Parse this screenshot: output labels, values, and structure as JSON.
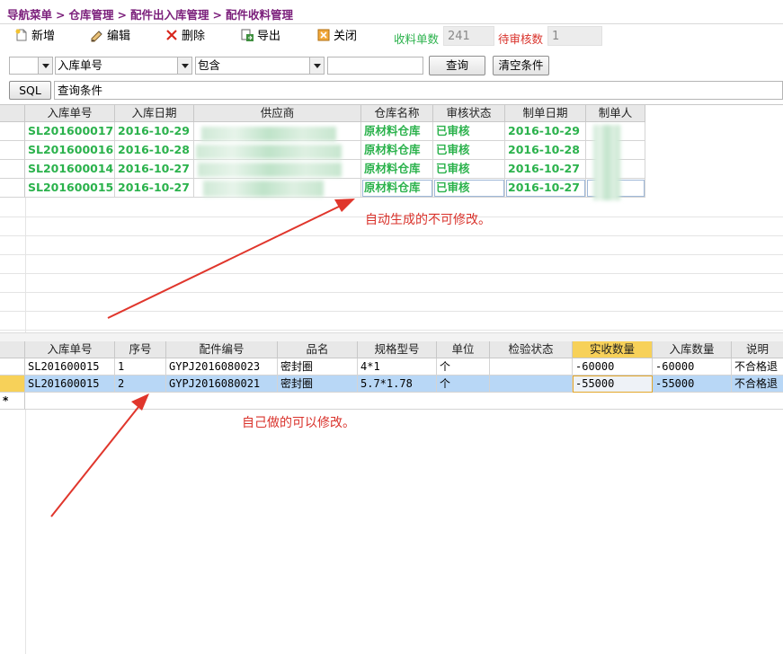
{
  "breadcrumb": [
    "导航菜单",
    "仓库管理",
    "配件出入库管理",
    "配件收料管理"
  ],
  "breadcrumb_sep": ">",
  "toolbar": {
    "new_label": "新增",
    "edit_label": "编辑",
    "delete_label": "删除",
    "export_label": "导出",
    "close_label": "关闭",
    "received_count_label": "收料单数",
    "received_count_value": "241",
    "pending_review_label": "待审核数",
    "pending_review_value": "1"
  },
  "filter": {
    "field_value": "入库单号",
    "operator_value": "包含",
    "query_button": "查询",
    "clear_button": "清空条件",
    "sql_button": "SQL",
    "condition_text": "查询条件"
  },
  "master_grid": {
    "columns": [
      "入库单号",
      "入库日期",
      "供应商",
      "仓库名称",
      "审核状态",
      "制单日期",
      "制单人"
    ],
    "rows": [
      {
        "id": "SL201600017",
        "date": "2016-10-29",
        "warehouse": "原材料仓库",
        "status": "已审核",
        "made_date": "2016-10-29"
      },
      {
        "id": "SL201600016",
        "date": "2016-10-28",
        "warehouse": "原材料仓库",
        "status": "已审核",
        "made_date": "2016-10-28"
      },
      {
        "id": "SL201600014",
        "date": "2016-10-27",
        "warehouse": "原材料仓库",
        "status": "已审核",
        "made_date": "2016-10-27"
      },
      {
        "id": "SL201600015",
        "date": "2016-10-27",
        "warehouse": "原材料仓库",
        "status": "已审核",
        "made_date": "2016-10-27"
      }
    ]
  },
  "detail_grid": {
    "columns": [
      "入库单号",
      "序号",
      "配件编号",
      "品名",
      "规格型号",
      "单位",
      "检验状态",
      "实收数量",
      "入库数量",
      "说明"
    ],
    "rows": [
      {
        "id": "SL201600015",
        "seq": "1",
        "part_no": "GYPJ2016080023",
        "name": "密封圈",
        "spec": "4*1",
        "unit": "个",
        "inspect": "",
        "received": "-60000",
        "stored": "-60000",
        "note": "不合格退"
      },
      {
        "id": "SL201600015",
        "seq": "2",
        "part_no": "GYPJ2016080021",
        "name": "密封圈",
        "spec": "5.7*1.78",
        "unit": "个",
        "inspect": "",
        "received": "-55000",
        "stored": "-55000",
        "note": "不合格退"
      }
    ],
    "new_row_marker": "*"
  },
  "annotations": {
    "auto_generated": "自动生成的不可修改。",
    "self_made": "自己做的可以修改。"
  },
  "colors": {
    "breadcrumb": "#7b1f7b",
    "green_text": "#2bb24c",
    "annotation_red": "#d9322b",
    "selected_row": "#b8d7f6",
    "active_header": "#f7d159"
  }
}
